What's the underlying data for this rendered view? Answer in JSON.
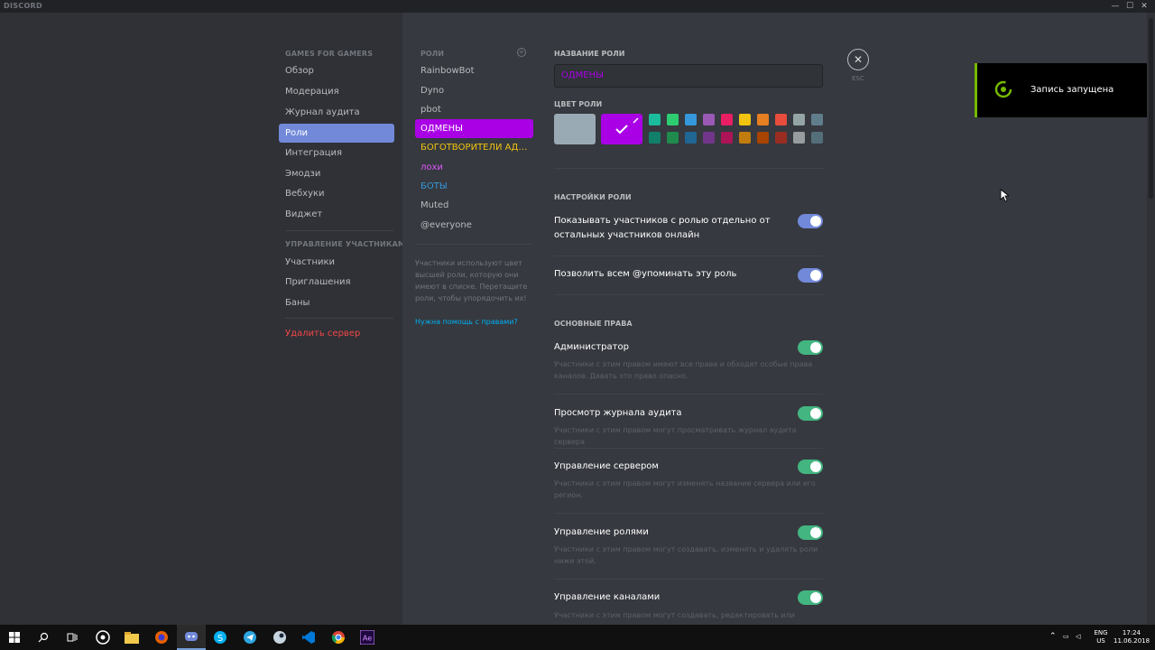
{
  "titlebar": {
    "brand": "DISCORD",
    "minimize": "—",
    "maximize": "☐",
    "close": "✕"
  },
  "sidebar": {
    "server_header": "GAMES FOR GAMERS",
    "items": [
      {
        "label": "Обзор"
      },
      {
        "label": "Модерация"
      },
      {
        "label": "Журнал аудита"
      },
      {
        "label": "Роли",
        "active": true
      },
      {
        "label": "Интеграция"
      },
      {
        "label": "Эмодзи"
      },
      {
        "label": "Вебхуки"
      },
      {
        "label": "Виджет"
      }
    ],
    "members_header": "УПРАВЛЕНИЕ УЧАСТНИКАМИ",
    "member_items": [
      {
        "label": "Участники"
      },
      {
        "label": "Приглашения"
      },
      {
        "label": "Баны"
      }
    ],
    "delete_server": "Удалить сервер"
  },
  "roles": {
    "header": "РОЛИ",
    "add_icon": "plus-circle-icon",
    "items": [
      {
        "label": "RainbowBot",
        "color": "#b9bbbe"
      },
      {
        "label": "Dyno",
        "color": "#b9bbbe"
      },
      {
        "label": "pbot",
        "color": "#b9bbbe"
      },
      {
        "label": "ОДМЕНЫ",
        "color": "#ffffff",
        "active": true
      },
      {
        "label": "БОГОТВОРИТЕЛИ АДМ...",
        "color": "#f1c40f"
      },
      {
        "label": "лохи",
        "color": "#e056fd"
      },
      {
        "label": "БОТЫ",
        "color": "#3498db"
      },
      {
        "label": "Muted",
        "color": "#b9bbbe"
      },
      {
        "label": "@everyone",
        "color": "#b9bbbe"
      }
    ],
    "hint": "Участники используют цвет высшей роли, которую они имеют в списке. Перетащите роли, чтобы упорядочить их!",
    "help_link": "Нужна помощь с правами?"
  },
  "editor": {
    "name_label": "НАЗВАНИЕ РОЛИ",
    "name_value": "ОДМЕНЫ",
    "color_label": "ЦВЕТ РОЛИ",
    "default_color": "#99aab5",
    "custom_color": "#aa00e6",
    "swatches_top": [
      "#1abc9c",
      "#2ecc71",
      "#3498db",
      "#9b59b6",
      "#e91e63",
      "#f1c40f",
      "#e67e22",
      "#e74c3c",
      "#95a5a6",
      "#607d8b"
    ],
    "swatches_bottom": [
      "#11806a",
      "#1f8b4c",
      "#206694",
      "#71368a",
      "#ad1457",
      "#c27c0e",
      "#a84300",
      "#992d22",
      "#979c9f",
      "#546e7a"
    ],
    "settings_label": "НАСТРОЙКИ РОЛИ",
    "settings": [
      {
        "title": "Показывать участников с ролью отдельно от остальных участников онлайн",
        "on": true
      },
      {
        "title": "Позволить всем @упоминать эту роль",
        "on": true
      }
    ],
    "perms_label": "ОСНОВНЫЕ ПРАВА",
    "permissions": [
      {
        "title": "Администратор",
        "desc": "Участники с этим правом имеют все права и обходят особые права каналов. Давать это право опасно.",
        "on": true
      },
      {
        "title": "Просмотр журнала аудита",
        "desc": "Участники с этим правом могут просматривать журнал аудита сервера",
        "on": true
      },
      {
        "title": "Управление сервером",
        "desc": "Участники с этим правом могут изменять название сервера или его регион.",
        "on": true
      },
      {
        "title": "Управление ролями",
        "desc": "Участники с этим правом могут создавать, изменять и удалять роли ниже этой.",
        "on": true
      },
      {
        "title": "Управление каналами",
        "desc": "Участники с этим правом могут создавать, редактировать или удалять",
        "on": true
      }
    ],
    "toggle_blurple": "#7289da",
    "toggle_green": "#43b581"
  },
  "close": {
    "icon": "close-icon",
    "esc_label": "ESC"
  },
  "toast": {
    "text": "Запись запущена",
    "icon": "nvidia-record-icon",
    "accent": "#76b900"
  },
  "taskbar": {
    "apps": [
      "windows-start-icon",
      "search-icon",
      "task-view-icon",
      "obs-icon",
      "file-explorer-icon",
      "firefox-icon",
      "discord-icon",
      "skype-icon",
      "telegram-icon",
      "steam-icon",
      "vscode-icon",
      "chrome-icon",
      "after-effects-icon"
    ],
    "lang_top": "ENG",
    "lang_bottom": "US",
    "time": "17:24",
    "date": "11.06.2018"
  }
}
